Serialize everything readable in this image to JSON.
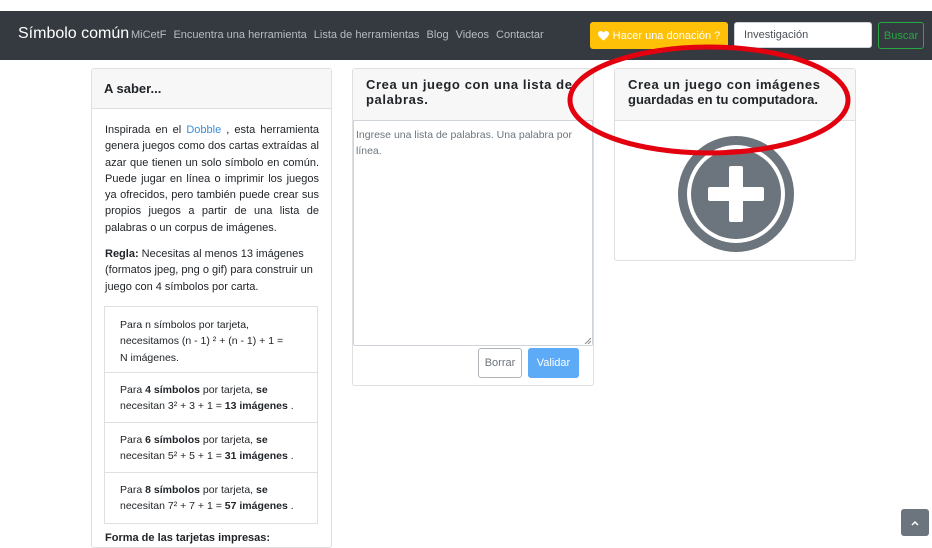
{
  "navbar": {
    "brand": "Símbolo común",
    "links": [
      "MiCetF",
      "Encuentra una herramienta",
      "Lista de herramientas",
      "Blog",
      "Videos",
      "Contactar"
    ],
    "donate_label": "Hacer una donación ?",
    "search_value": "Investigación",
    "search_button": "Buscar"
  },
  "left_card": {
    "title": "A saber...",
    "intro_prefix": "Inspirada en el ",
    "intro_link": "Dobble",
    "intro_suffix": " , esta herramienta genera juegos como dos cartas extraídas al azar que tienen un solo símbolo en común. Puede jugar en línea o imprimir los juegos ya ofrecidos, pero también puede crear sus propios juegos a partir de una lista de palabras o un corpus de imágenes.",
    "rule_label": "Regla:",
    "rule_text": " Necesitas al menos 13 imágenes (formatos jpeg, png o gif) para construir un juego con 4 símbolos por carta.",
    "list": [
      {
        "line1": "Para n símbolos por tarjeta,",
        "line2": "necesitamos (n - 1) ² + (n - 1) + 1 =",
        "line3": "N imágenes."
      },
      {
        "pre": "Para ",
        "bold1": "4 símbolos",
        "mid": " por tarjeta, ",
        "bold2": "se",
        "line2_pre": "necesitan 3² + 3 + 1 = ",
        "bold3": "13 imágenes",
        "end": " ."
      },
      {
        "pre": "Para ",
        "bold1": "6 símbolos",
        "mid": " por tarjeta, ",
        "bold2": "se",
        "line2_pre": "necesitan 5² + 5 + 1 = ",
        "bold3": "31 imágenes",
        "end": " ."
      },
      {
        "pre": "Para ",
        "bold1": "8 símbolos",
        "mid": " por tarjeta, ",
        "bold2": "se",
        "line2_pre": "necesitan 7² + 7 + 1 = ",
        "bold3": "57 imágenes",
        "end": " ."
      }
    ],
    "cut_text": "Forma de las tarjetas impresas:"
  },
  "middle_card": {
    "title_line1": "Crea un juego con una lista de",
    "title_line2": "palabras.",
    "placeholder": "Ingrese una lista de palabras.  Una palabra por línea.",
    "clear_button": "Borrar",
    "validate_button": "Validar"
  },
  "right_card": {
    "title_line1": "Crea un juego con imágenes",
    "title_line2": "guardadas en tu computadora.",
    "icon": "plus-circle-icon"
  },
  "colors": {
    "navbar": "#343a40",
    "donate": "#ffc107",
    "search_button": "#28a745",
    "validate": "#5daaf7",
    "annotation": "#e3000f",
    "icon": "#6c757d"
  }
}
